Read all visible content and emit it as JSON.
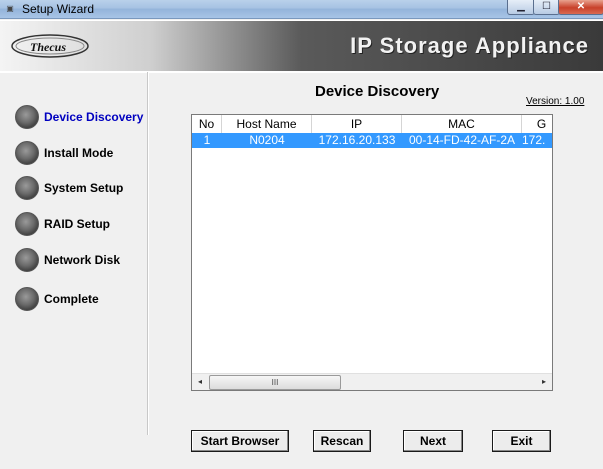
{
  "window": {
    "title": "Setup Wizard",
    "app_icon": "thecus-icon",
    "minimize_glyph": "▁",
    "maximize_glyph": "☐",
    "close_glyph": "✕"
  },
  "banner": {
    "logo": "Thecus",
    "title": "IP Storage Appliance"
  },
  "steps": [
    {
      "label": "Device Discovery",
      "active": true
    },
    {
      "label": "Install Mode",
      "active": false
    },
    {
      "label": "System Setup",
      "active": false
    },
    {
      "label": "RAID Setup",
      "active": false
    },
    {
      "label": "Network Disk",
      "active": false
    },
    {
      "label": "Complete",
      "active": false
    }
  ],
  "main": {
    "title": "Device Discovery",
    "version": "Version: 1.00",
    "table": {
      "columns": [
        "No",
        "Host Name",
        "IP",
        "MAC",
        "G"
      ],
      "rows": [
        {
          "no": "1",
          "host": "N0204",
          "ip": "172.16.20.133",
          "mac": "00-14-FD-42-AF-2A",
          "g": "172."
        }
      ],
      "selected_row": 0,
      "scroll": {
        "left_arrow": "◂",
        "right_arrow": "▸",
        "thumb_glyph": "III"
      }
    }
  },
  "buttons": {
    "start_browser": "Start Browser",
    "rescan": "Rescan",
    "next": "Next",
    "exit": "Exit"
  },
  "colors": {
    "selection": "#3399ff",
    "active_step": "#0000c0"
  }
}
